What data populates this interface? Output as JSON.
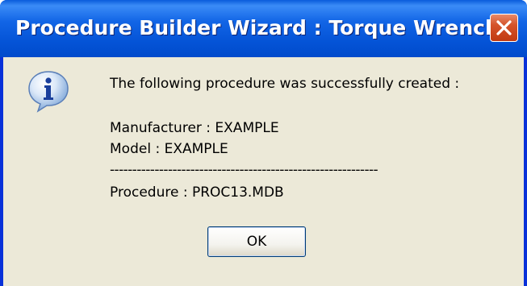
{
  "window": {
    "title": "Procedure Builder Wizard : Torque Wrench"
  },
  "icon": {
    "name": "info-icon",
    "glyph": "i"
  },
  "message": {
    "line1": "The following procedure was successfully created :",
    "manufacturer": "Manufacturer : EXAMPLE",
    "model": "Model : EXAMPLE",
    "separator": "------------------------------------------------------------",
    "procedure": "Procedure : PROC13.MDB"
  },
  "buttons": {
    "ok_label": "OK"
  },
  "colors": {
    "titlebar": "#0054e3",
    "client_bg": "#ece9d8",
    "close_button": "#c13a12"
  }
}
